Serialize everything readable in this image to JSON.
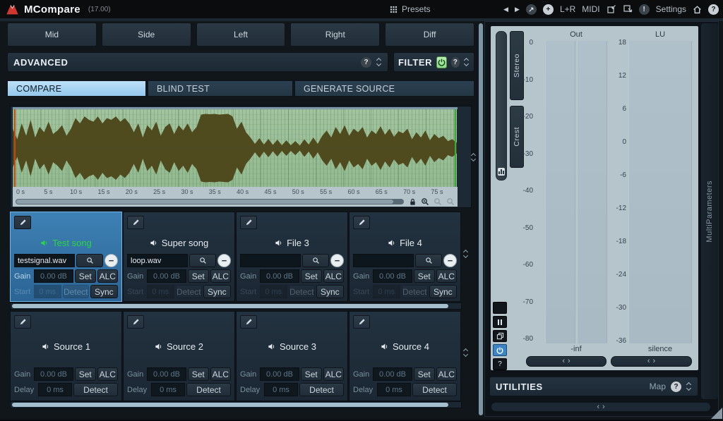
{
  "titlebar": {
    "app_name": "MCompare",
    "version": "(17.00)",
    "presets_label": "Presets",
    "lr_label": "L+R",
    "midi_label": "MIDI",
    "settings_label": "Settings"
  },
  "channel_buttons": [
    "Mid",
    "Side",
    "Left",
    "Right",
    "Diff"
  ],
  "sections": {
    "advanced_label": "ADVANCED",
    "filter_label": "FILTER",
    "utilities_label": "UTILITIES",
    "map_label": "Map",
    "multiparameters_label": "MultiParameters"
  },
  "tabs": [
    {
      "label": "COMPARE",
      "active": true
    },
    {
      "label": "BLIND TEST",
      "active": false
    },
    {
      "label": "GENERATE SOURCE",
      "active": false
    }
  ],
  "waveform": {
    "time_labels": [
      "0 s",
      "5 s",
      "10 s",
      "15 s",
      "20 s",
      "25 s",
      "30 s",
      "35 s",
      "40 s",
      "45 s",
      "50 s",
      "55 s",
      "60 s",
      "65 s",
      "70 s",
      "75 s"
    ],
    "bg_color": "#9abf97",
    "wave_color": "#4f4b1f",
    "amplitudes": [
      0.55,
      0.25,
      0.7,
      0.35,
      0.8,
      0.3,
      0.6,
      0.45,
      0.75,
      0.4,
      0.5,
      0.65,
      0.35,
      0.55,
      0.85,
      0.7,
      0.9,
      0.8,
      0.75,
      0.9,
      0.7,
      0.85,
      0.8,
      0.9,
      0.75,
      0.85,
      0.7,
      0.45,
      0.7,
      0.3,
      0.65,
      0.5,
      0.75,
      0.35,
      0.6,
      0.7,
      0.4,
      0.65,
      0.5,
      0.7,
      0.45,
      0.6,
      0.95,
      0.97,
      0.96,
      0.97,
      0.95,
      0.96,
      0.97,
      0.9,
      0.55,
      0.75,
      0.45,
      0.3,
      0.12,
      0.28,
      0.1,
      0.26,
      0.09,
      0.24,
      0.08,
      0.22,
      0.08,
      0.2,
      0.07,
      0.25,
      0.1,
      0.3,
      0.12,
      0.35,
      0.5,
      0.3,
      0.6,
      0.4,
      0.65,
      0.35,
      0.55,
      0.45,
      0.6,
      0.3,
      0.5,
      0.4,
      0.62,
      0.38,
      0.55,
      0.32,
      0.48,
      0.42,
      0.55,
      0.25,
      0.45,
      0.3,
      0.5,
      0.22,
      0.4,
      0.28,
      0.35,
      0.2,
      0.25,
      0.15
    ]
  },
  "labels": {
    "gain": "Gain",
    "set": "Set",
    "alc": "ALC",
    "start": "Start",
    "delay": "Delay",
    "detect": "Detect",
    "sync": "Sync"
  },
  "file_slots": [
    {
      "name": "Test song",
      "file": "testsignal.wav",
      "gain": "0.00 dB",
      "start": "0 ms",
      "selected": true
    },
    {
      "name": "Super song",
      "file": "loop.wav",
      "gain": "0.00 dB",
      "start": "0 ms",
      "selected": false
    },
    {
      "name": "File 3",
      "file": "",
      "gain": "0.00 dB",
      "start": "0 ms",
      "selected": false
    },
    {
      "name": "File 4",
      "file": "",
      "gain": "0.00 dB",
      "start": "0 ms",
      "selected": false
    }
  ],
  "source_slots": [
    {
      "name": "Source 1",
      "gain": "0.00 dB",
      "delay": "0 ms"
    },
    {
      "name": "Source 2",
      "gain": "0.00 dB",
      "delay": "0 ms"
    },
    {
      "name": "Source 3",
      "gain": "0.00 dB",
      "delay": "0 ms"
    },
    {
      "name": "Source 4",
      "gain": "0.00 dB",
      "delay": "0 ms"
    }
  ],
  "meters": {
    "out": {
      "title": "Out",
      "scale": [
        "0",
        "-10",
        "-20",
        "-30",
        "-40",
        "-50",
        "-60",
        "-70",
        "-80"
      ],
      "bottom_label": "-inf"
    },
    "lu": {
      "title": "LU",
      "scale": [
        "18",
        "12",
        "6",
        "0",
        "-6",
        "-12",
        "-18",
        "-24",
        "-30",
        "-36"
      ],
      "bottom_label": "silence"
    },
    "stereo_label": "Stereo",
    "crest_label": "Crest"
  },
  "icons": {
    "logo": "melda-mountain-triangle",
    "presets": "grid-dots",
    "prev": "left-triangle",
    "next": "right-triangle",
    "randomize": "diagonal-arrow-circle",
    "add": "plus-circle",
    "import": "box-arrow-in",
    "export": "box-arrow-out",
    "alert": "exclamation-circle",
    "home": "house",
    "help": "question-circle",
    "collapse": "chevron-up-down",
    "edit": "pencil",
    "speaker": "speaker-wave",
    "browse": "magnifier",
    "remove": "minus-circle",
    "lock": "padlock",
    "zoom_in": "magnifier-plus",
    "power": "power-symbol",
    "pause": "pause-bars",
    "windows": "overlapping-squares"
  },
  "colors": {
    "accent_blue": "#3d84c4",
    "selected_slot": "#2f6da0",
    "active_tab": "#a9d6f4",
    "filter_on_green": "#a3e89e",
    "test_song_green": "#2bd63f",
    "meter_bg": "#b6c4cc",
    "wave_bg": "#9abf97",
    "wave_fg": "#4f4b1f"
  }
}
